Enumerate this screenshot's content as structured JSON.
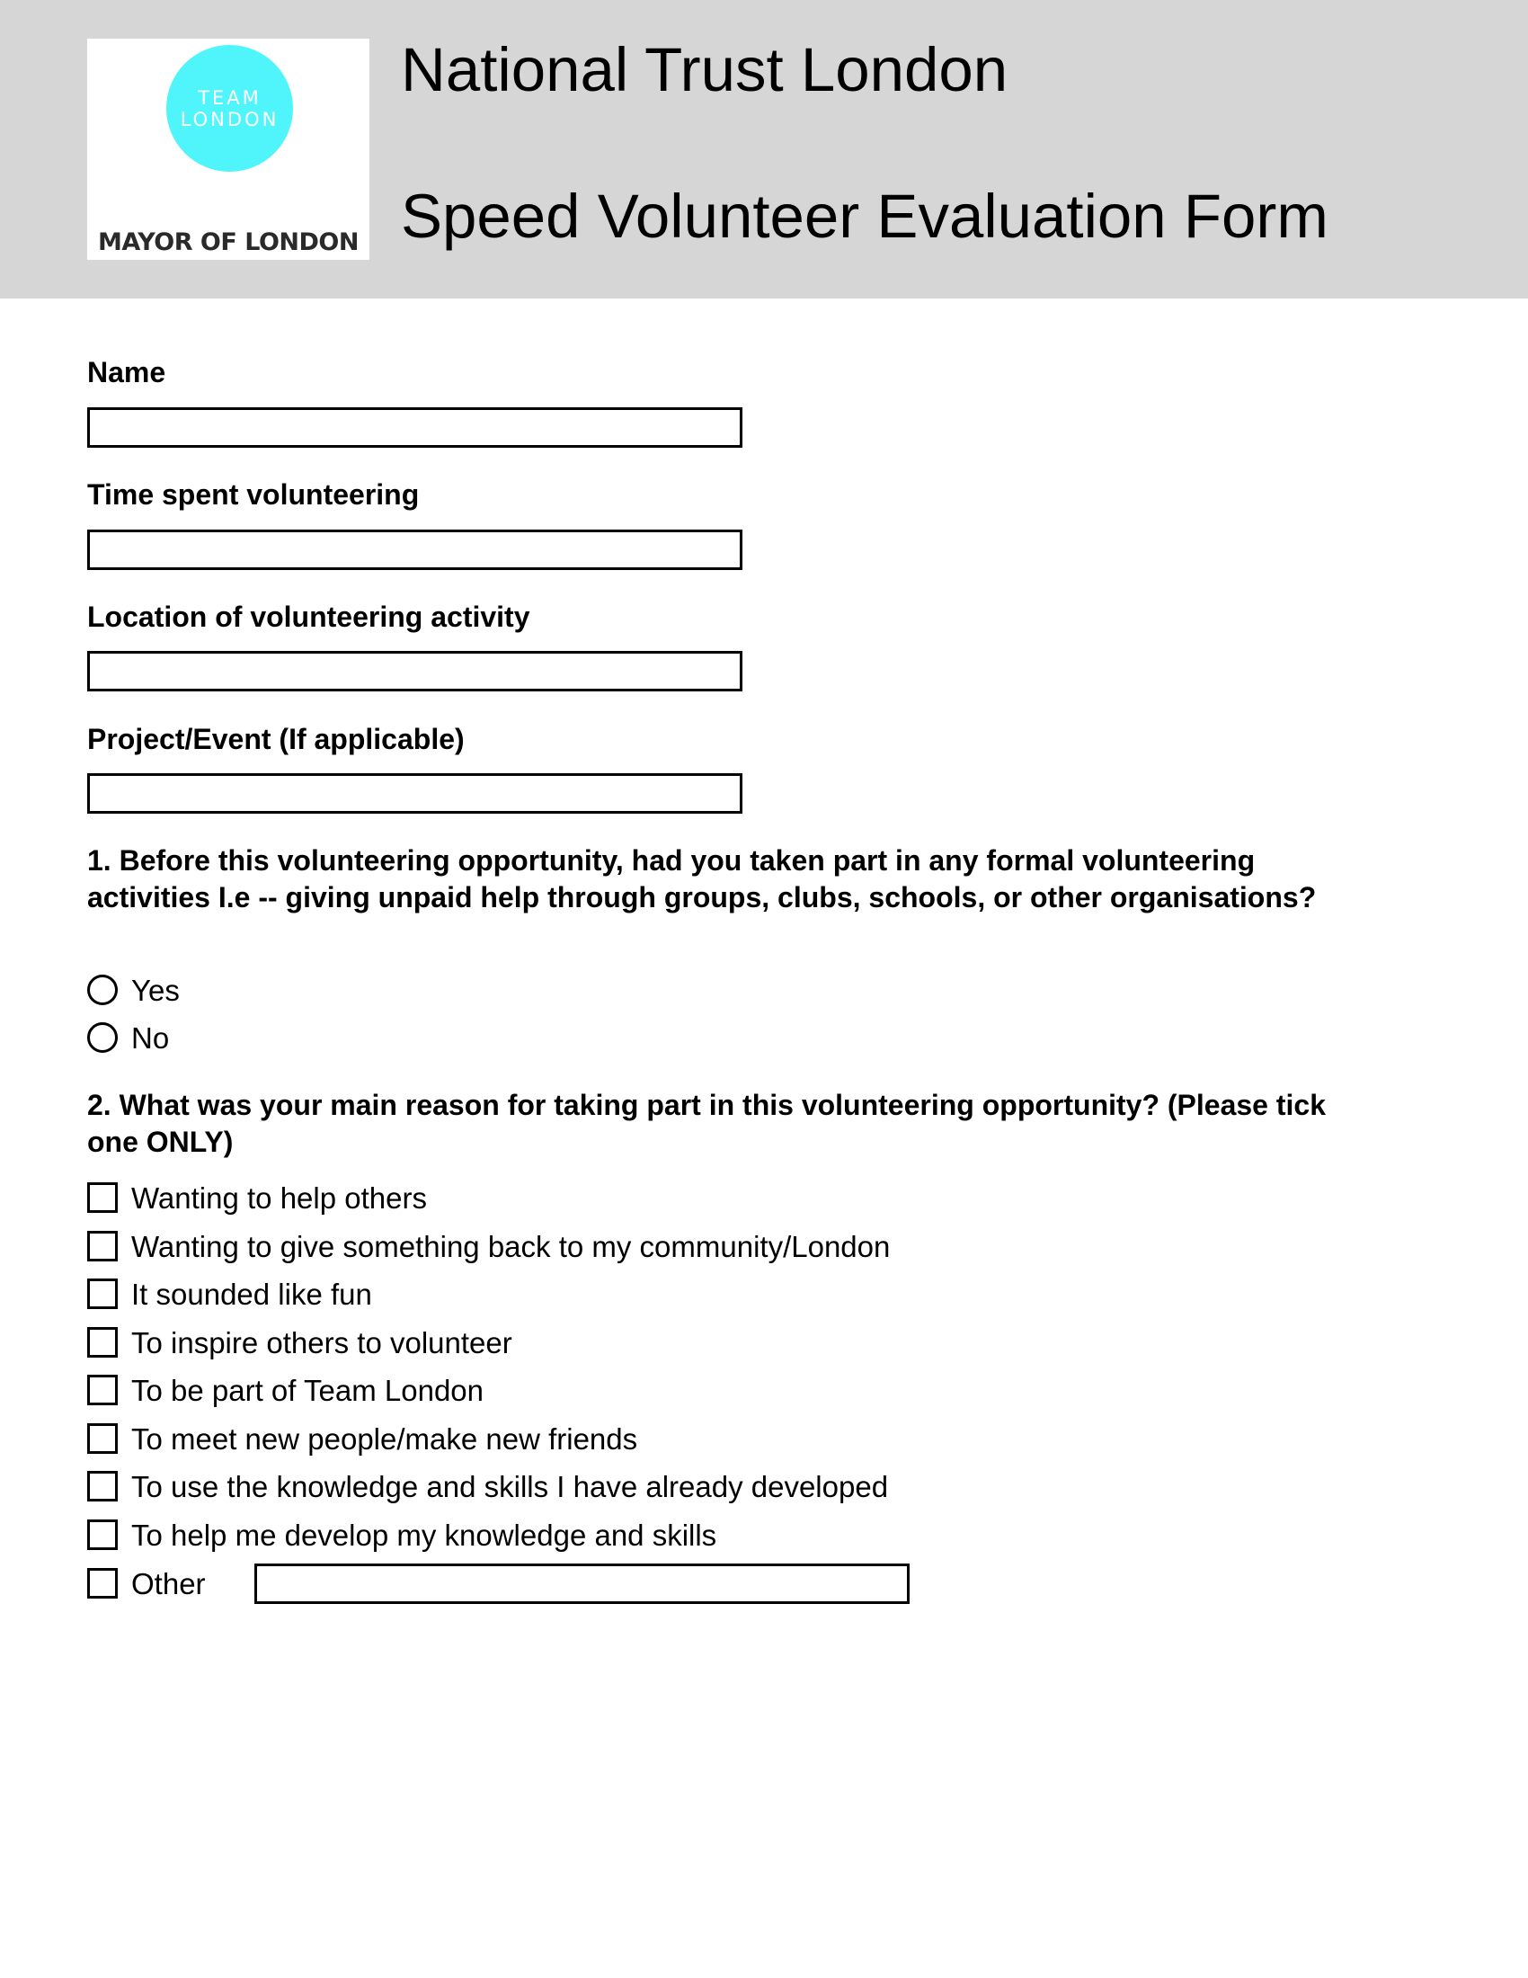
{
  "header": {
    "logo": {
      "circle_line1": "TEAM",
      "circle_line2": "LONDON",
      "org_name": "MAYOR OF LONDON",
      "circle_color": "#4ff5fb"
    },
    "title_line1": "National Trust London",
    "title_line2": "Speed Volunteer Evaluation Form",
    "band_color": "#d6d6d6"
  },
  "fields": [
    {
      "label": "Name",
      "value": "",
      "placeholder": ""
    },
    {
      "label": "Time spent volunteering",
      "value": "",
      "placeholder": ""
    },
    {
      "label": "Location of volunteering activity",
      "value": "",
      "placeholder": ""
    },
    {
      "label": "Project/Event (If applicable)",
      "value": "",
      "placeholder": ""
    }
  ],
  "question1": {
    "text": "1. Before this volunteering opportunity, had you taken part in any formal volunteering activities I.e -- giving unpaid help through groups, clubs, schools, or other organisations?",
    "options": [
      {
        "label": "Yes",
        "selected": false
      },
      {
        "label": "No",
        "selected": false
      }
    ]
  },
  "question2": {
    "text": "2. What was your main reason for taking part in this volunteering opportunity? (Please tick one ONLY)",
    "options": [
      {
        "label": "Wanting to help others",
        "checked": false
      },
      {
        "label": "Wanting to give something back to my community/London",
        "checked": false
      },
      {
        "label": "It sounded like fun",
        "checked": false
      },
      {
        "label": "To inspire others to volunteer",
        "checked": false
      },
      {
        "label": "To be part of Team London",
        "checked": false
      },
      {
        "label": "To meet new people/make new friends",
        "checked": false
      },
      {
        "label": "To use the knowledge and skills I have already developed",
        "checked": false
      },
      {
        "label": "To help me develop my knowledge and skills",
        "checked": false
      },
      {
        "label": "Other",
        "checked": false
      }
    ],
    "other_value": ""
  }
}
